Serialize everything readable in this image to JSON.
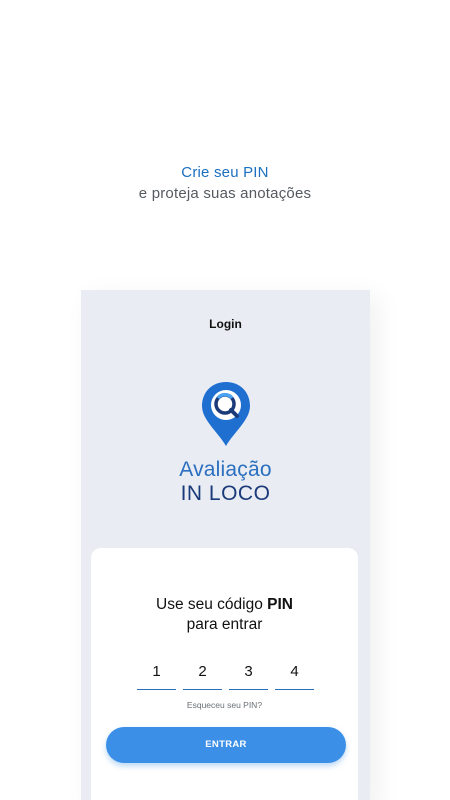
{
  "headline": {
    "title": "Crie seu PIN",
    "subtitle": "e proteja suas anotações"
  },
  "screen": {
    "title": "Login",
    "logo": {
      "line1": "Avaliação",
      "line2": "IN LOCO",
      "icon": "map-pin-search-icon"
    }
  },
  "pin_card": {
    "title_prefix": "Use seu código ",
    "title_bold": "PIN",
    "title_line2": "para entrar",
    "digits": [
      "1",
      "2",
      "3",
      "4"
    ],
    "forgot_link": "Esqueceu seu PIN?",
    "enter_button": "ENTRAR"
  },
  "colors": {
    "accent": "#1a6fc0",
    "button": "#3b8fe6",
    "phone_bg": "#e9edf3",
    "logo_dark": "#1b3a7a"
  }
}
